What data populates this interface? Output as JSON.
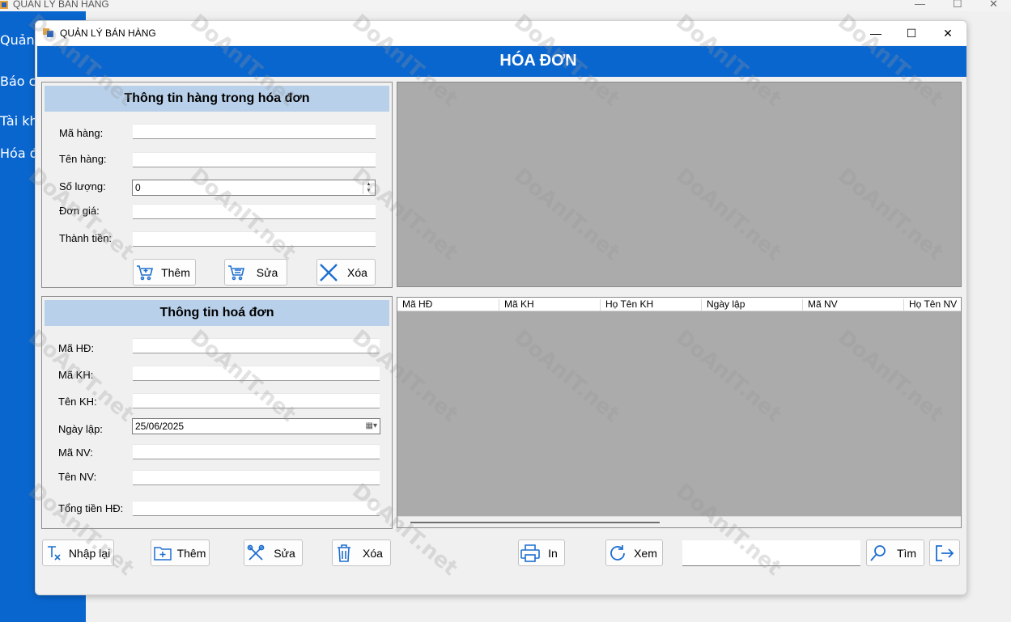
{
  "background_window": {
    "title": "QUẢN LÝ BÁN HÀNG",
    "menu_items": [
      "Quản",
      "Báo c",
      "Tài kh",
      "Hóa đ"
    ]
  },
  "window": {
    "title": "QUẢN LÝ BÁN HÀNG",
    "controls": {
      "minimize": "—",
      "maximize": "☐",
      "close": "✕"
    }
  },
  "banner": {
    "title": "HÓA ĐƠN"
  },
  "item_group": {
    "title": "Thông tin hàng trong hóa đơn",
    "labels": {
      "ma_hang": "Mã hàng:",
      "ten_hang": "Tên hàng:",
      "so_luong": "Số lượng:",
      "don_gia": "Đơn giá:",
      "thanh_tien": "Thành tiền:"
    },
    "values": {
      "so_luong": "0"
    },
    "buttons": {
      "add": "Thêm",
      "edit": "Sửa",
      "delete": "Xóa"
    }
  },
  "invoice_group": {
    "title": "Thông tin hoá đơn",
    "labels": {
      "ma_hd": "Mã HĐ:",
      "ma_kh": "Mã KH:",
      "ten_kh": "Tên KH:",
      "ngay_lap": "Ngày lập:",
      "ma_nv": "Mã NV:",
      "ten_nv": "Tên NV:",
      "tong_tien": "Tổng tiền HĐ:"
    },
    "values": {
      "ngay_lap": "25/06/2025"
    }
  },
  "grid": {
    "columns": [
      "Mã HĐ",
      "Mã KH",
      "Họ Tên KH",
      "Ngày lập",
      "Mã NV",
      "Họ Tên NV"
    ]
  },
  "bottom_buttons": {
    "reset": "Nhập lại",
    "add": "Thêm",
    "edit": "Sửa",
    "delete": "Xóa",
    "print": "In",
    "view": "Xem",
    "search": "Tìm"
  },
  "search": {
    "value": ""
  },
  "watermark": "DoAnIT.net",
  "colors": {
    "banner": "#0a66cf",
    "group_header": "#b8d0ea",
    "panel": "#ababab",
    "icon_blue": "#1e6fd0"
  }
}
